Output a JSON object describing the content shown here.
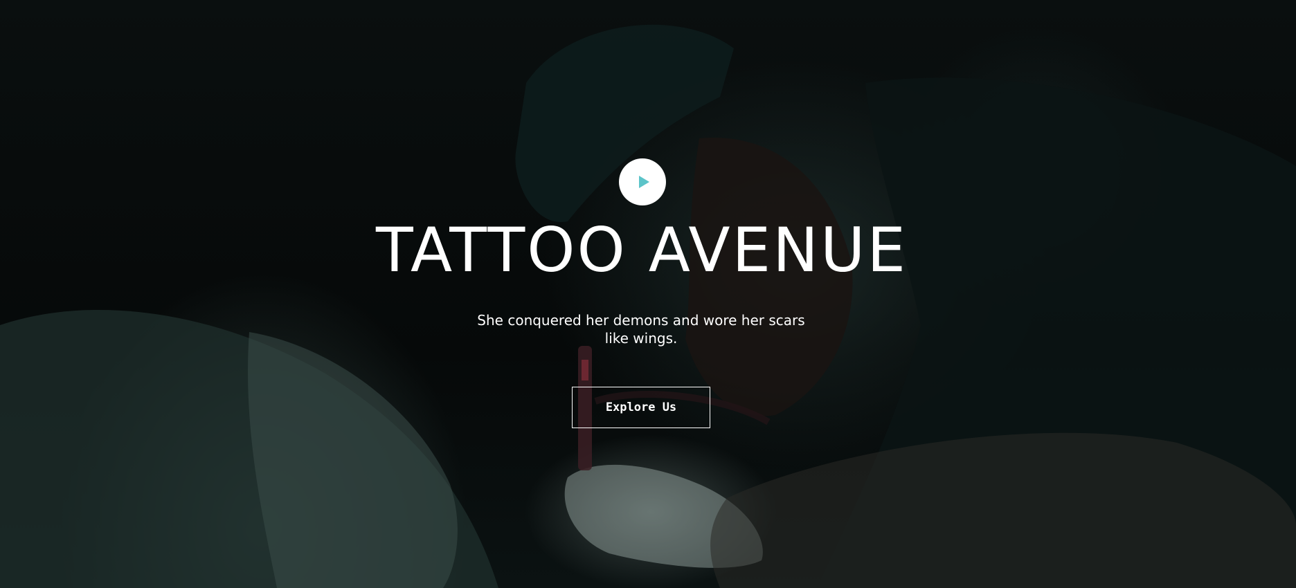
{
  "hero": {
    "background_image": "tattoo-artist-at-work-photo",
    "play_button": {
      "icon": "play-icon",
      "icon_color": "#5cc4c9"
    },
    "title": "TATTOO AVENUE",
    "subtitle": "She conquered her demons and wore her scars like wings.",
    "cta_label": "Explore Us"
  }
}
